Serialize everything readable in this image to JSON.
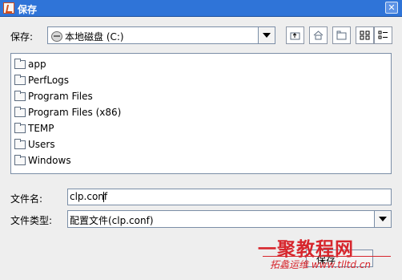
{
  "window": {
    "title": "保存",
    "close_symbol": "✕"
  },
  "look_in": {
    "label": "保存:",
    "value": "本地磁盘 (C:)",
    "drive_icon": "drive-icon"
  },
  "toolbar": {
    "buttons": [
      {
        "name": "up-one-level-button",
        "icon": "folder-up-icon"
      },
      {
        "name": "home-button",
        "icon": "home-icon"
      },
      {
        "name": "new-folder-button",
        "icon": "new-folder-icon"
      },
      {
        "name": "list-view-button",
        "icon": "list-view-icon"
      },
      {
        "name": "details-view-button",
        "icon": "details-view-icon"
      }
    ]
  },
  "files": [
    {
      "label": "app"
    },
    {
      "label": "PerfLogs"
    },
    {
      "label": "Program Files"
    },
    {
      "label": "Program Files (x86)"
    },
    {
      "label": "TEMP"
    },
    {
      "label": "Users"
    },
    {
      "label": "Windows"
    }
  ],
  "filename": {
    "label": "文件名:",
    "value": "clp.conf"
  },
  "filetype": {
    "label": "文件类型:",
    "value": "配置文件(clp.conf)"
  },
  "actions": {
    "save_label": "保存"
  },
  "watermark": {
    "chinese": "一聚教程网",
    "url": "拓蠡运维 www.tlltd.cn"
  },
  "colors": {
    "title_bar": "#2f74d8",
    "window_bg": "#eeeeee",
    "border": "#7b8ea7",
    "watermark": "#d7262d"
  }
}
